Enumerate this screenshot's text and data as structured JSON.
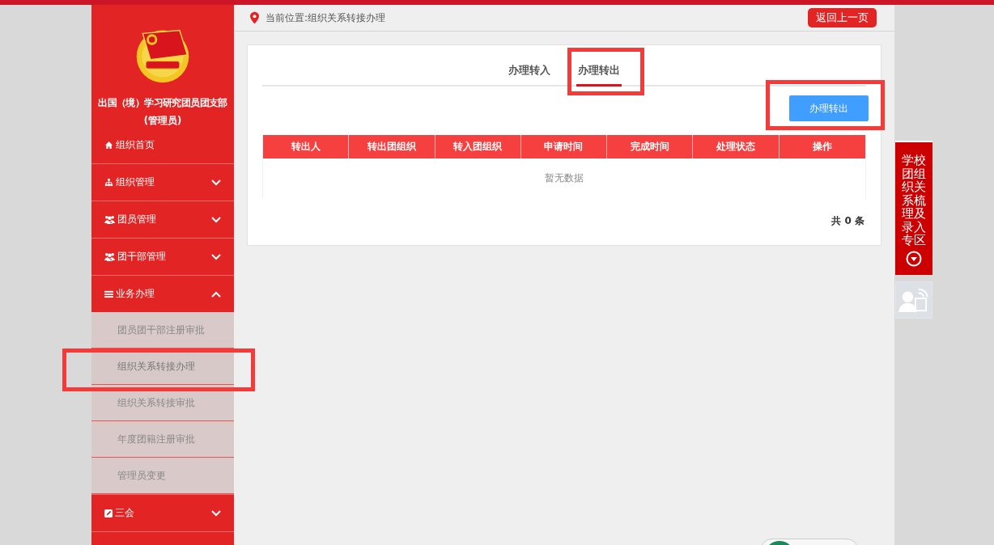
{
  "sidebar": {
    "org_name": "出国（境）学习研究团员团支部",
    "role": "(管理员)",
    "items": [
      {
        "label": "组织首页",
        "kind": "link"
      },
      {
        "label": "组织管理",
        "kind": "group",
        "expanded": false
      },
      {
        "label": "团员管理",
        "kind": "group",
        "expanded": false
      },
      {
        "label": "团干部管理",
        "kind": "group",
        "expanded": false
      },
      {
        "label": "业务办理",
        "kind": "group",
        "expanded": true,
        "children": [
          {
            "label": "团员团干部注册审批",
            "selected": false
          },
          {
            "label": "组织关系转接办理",
            "selected": true
          },
          {
            "label": "组织关系转接审批",
            "selected": false
          },
          {
            "label": "年度团籍注册审批",
            "selected": false
          },
          {
            "label": "管理员变更",
            "selected": false
          }
        ]
      },
      {
        "label": "三会",
        "kind": "group",
        "expanded": false
      }
    ]
  },
  "breadcrumb": {
    "text": "当前位置:组织关系转接办理",
    "back_button": "返回上一页"
  },
  "tabs": [
    {
      "label": "办理转入",
      "selected": false
    },
    {
      "label": "办理转出",
      "selected": true
    }
  ],
  "action_button": "办理转出",
  "table": {
    "columns": [
      "转出人",
      "转出团组织",
      "转入团组织",
      "申请时间",
      "完成时间",
      "处理状态",
      "操作"
    ],
    "empty_text": "暂无数据"
  },
  "total": "共 0 条",
  "side_panel": {
    "label": "学校团组织关系梳理及录入专区"
  }
}
